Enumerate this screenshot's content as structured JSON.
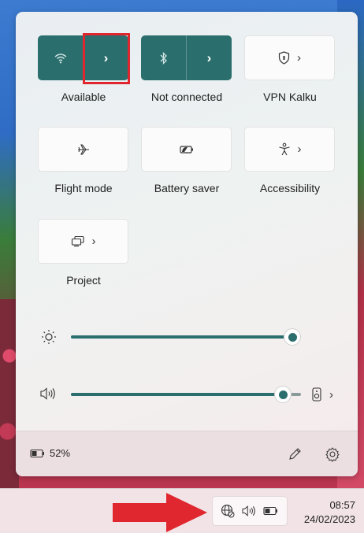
{
  "quick_settings": {
    "wifi": {
      "label": "Available",
      "icon": "wifi-icon"
    },
    "bluetooth": {
      "label": "Not connected",
      "icon": "bluetooth-icon"
    },
    "vpn": {
      "label": "VPN Kalku",
      "icon": "shield-icon"
    },
    "flight_mode": {
      "label": "Flight mode",
      "icon": "airplane-icon"
    },
    "battery_saver": {
      "label": "Battery saver",
      "icon": "battery-saver-icon"
    },
    "accessibility": {
      "label": "Accessibility",
      "icon": "accessibility-icon"
    },
    "project": {
      "label": "Project",
      "icon": "project-icon"
    }
  },
  "sliders": {
    "brightness": {
      "icon": "brightness-icon",
      "level": 0.97
    },
    "volume": {
      "icon": "volume-icon",
      "level": 0.92
    }
  },
  "footer": {
    "battery_percent": "52%"
  },
  "taskbar": {
    "time": "08:57",
    "date": "24/02/2023"
  },
  "colors": {
    "accent": "#2a6f6d",
    "highlight": "#e0262f"
  }
}
